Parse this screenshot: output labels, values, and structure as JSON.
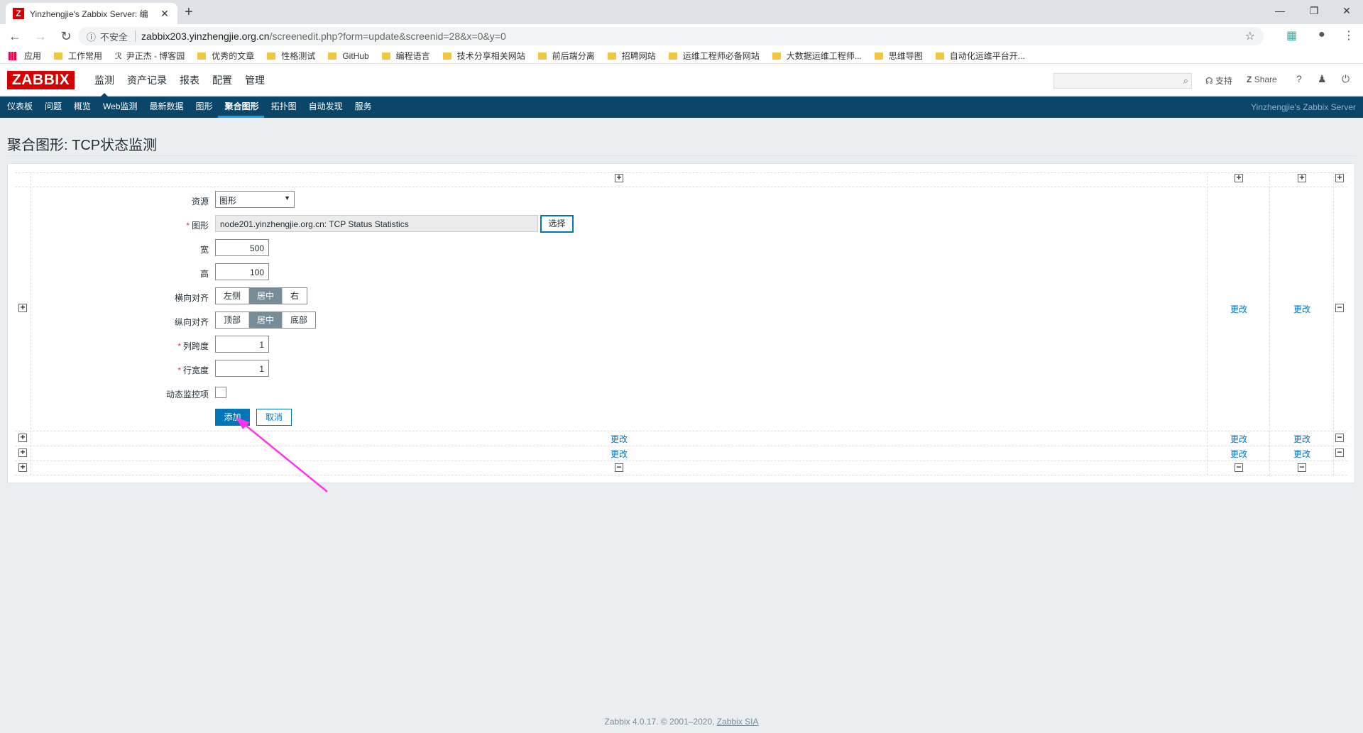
{
  "browser": {
    "tab_title": "Yinzhengjie's Zabbix Server: 编",
    "tab_favicon": "Z",
    "security_label": "不安全",
    "url_host": "zabbix203.yinzhengjie.org.cn",
    "url_path": "/screenedit.php?form=update&screenid=28&x=0&y=0",
    "bookmarks": [
      "应用",
      "工作常用",
      "尹正杰 - 博客园",
      "优秀的文章",
      "性格测试",
      "GitHub",
      "编程语言",
      "技术分享相关网站",
      "前后端分离",
      "招聘网站",
      "运维工程师必备网站",
      "大数据运维工程师...",
      "思维导图",
      "自动化运维平台开..."
    ]
  },
  "zabbix": {
    "logo": "ZABBIX",
    "top_menu": [
      "监测",
      "资产记录",
      "报表",
      "配置",
      "管理"
    ],
    "support": "支持",
    "share": "Share",
    "help": "?",
    "sub_menu": [
      "仪表板",
      "问题",
      "概览",
      "Web监测",
      "最新数据",
      "图形",
      "聚合图形",
      "拓扑图",
      "自动发现",
      "服务"
    ],
    "server_name": "Yinzhengjie's Zabbix Server"
  },
  "page": {
    "title": "聚合图形: TCP状态监测"
  },
  "form": {
    "resource_label": "资源",
    "resource_value": "图形",
    "graph_label": "图形",
    "graph_value": "node201.yinzhengjie.org.cn: TCP Status Statistics",
    "select_button": "选择",
    "width_label": "宽",
    "width_value": "500",
    "height_label": "高",
    "height_value": "100",
    "halign_label": "横向对齐",
    "halign_options": [
      "左侧",
      "居中",
      "右"
    ],
    "halign_selected": "居中",
    "valign_label": "纵向对齐",
    "valign_options": [
      "顶部",
      "居中",
      "底部"
    ],
    "valign_selected": "居中",
    "colspan_label": "列跨度",
    "colspan_value": "1",
    "rowspan_label": "行宽度",
    "rowspan_value": "1",
    "dynamic_label": "动态监控项",
    "add_button": "添加",
    "cancel_button": "取消"
  },
  "grid": {
    "change_link": "更改"
  },
  "footer": {
    "text": "Zabbix 4.0.17. © 2001–2020, ",
    "link": "Zabbix SIA"
  }
}
